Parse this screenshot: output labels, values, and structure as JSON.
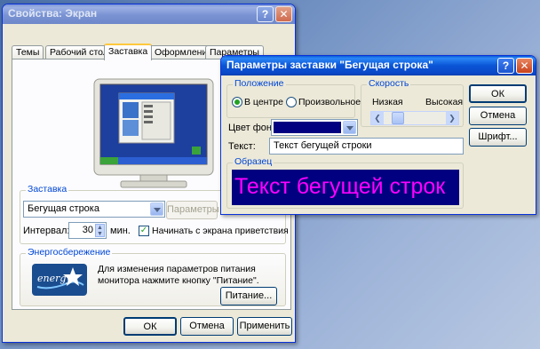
{
  "display_props": {
    "title": "Свойства: Экран",
    "tabs": [
      "Темы",
      "Рабочий стол",
      "Заставка",
      "Оформление",
      "Параметры"
    ],
    "active_tab": "Заставка",
    "screensaver_group": {
      "label": "Заставка",
      "selected": "Бегущая строка",
      "params_button": "Параметры",
      "interval_label": "Интервал:",
      "interval_value": "30",
      "interval_unit": "мин.",
      "welcome_checkbox": "Начинать с экрана приветствия",
      "welcome_checked": true
    },
    "power_group": {
      "label": "Энергосбережение",
      "logo_text": "energy",
      "description": "Для изменения параметров питания монитора нажмите кнопку \"Питание\".",
      "power_button": "Питание..."
    },
    "buttons": {
      "ok": "ОК",
      "cancel": "Отмена",
      "apply": "Применить"
    }
  },
  "marquee_settings": {
    "title": "Параметры заставки \"Бегущая строка\"",
    "position_group": {
      "label": "Положение",
      "center": "В центре",
      "random": "Произвольное",
      "selected": "center"
    },
    "speed_group": {
      "label": "Скорость",
      "low": "Низкая",
      "high": "Высокая",
      "slider_value": 0.15
    },
    "bg_color_label": "Цвет фона:",
    "bg_color": "#000080",
    "text_label": "Текст:",
    "text_value": "Текст бегущей строки",
    "sample_group": {
      "label": "Образец",
      "preview_text": "Текст бегущей строк",
      "preview_text_color": "#ff00ff",
      "preview_bg_color": "#000080"
    },
    "buttons": {
      "ok": "ОК",
      "cancel": "Отмена",
      "font": "Шрифт..."
    }
  }
}
